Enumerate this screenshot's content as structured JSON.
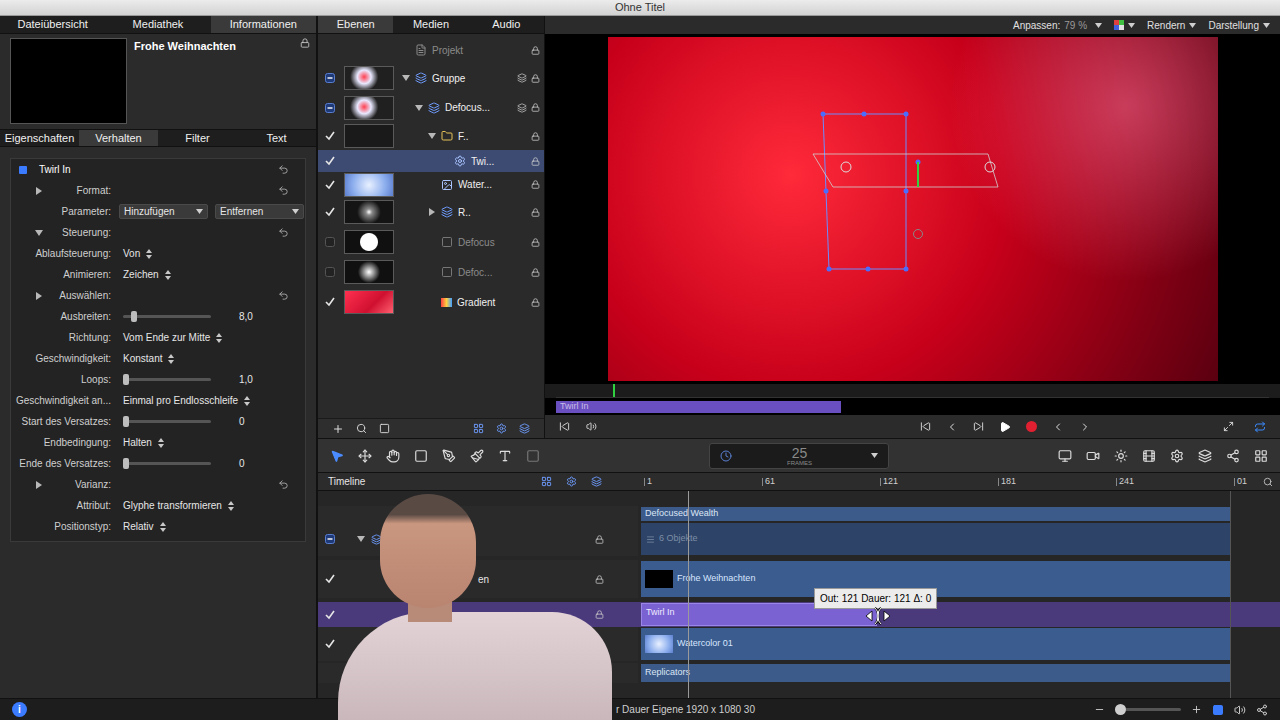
{
  "window": {
    "title": "Ohne Titel"
  },
  "inspector": {
    "tabs": [
      {
        "label": "Dateiübersicht",
        "selected": false
      },
      {
        "label": "Mediathek",
        "selected": false
      },
      {
        "label": "Informationen",
        "selected": true
      }
    ],
    "preview": {
      "title": "Frohe Weihnachten"
    },
    "subtabs": [
      {
        "label": "Eigenschaften",
        "selected": false
      },
      {
        "label": "Verhalten",
        "selected": true
      },
      {
        "label": "Filter",
        "selected": false
      },
      {
        "label": "Text",
        "selected": false
      }
    ],
    "behavior": {
      "name": "Twirl In",
      "enabled": true
    },
    "params": [
      {
        "kind": "section",
        "label": "Format:",
        "expanded": false
      },
      {
        "kind": "buttons",
        "label": "Parameter:",
        "buttons": [
          "Hinzufügen",
          "Entfernen"
        ]
      },
      {
        "kind": "section",
        "label": "Steuerung:",
        "expanded": true
      },
      {
        "kind": "popup",
        "label": "Ablaufsteuerung:",
        "value": "Von"
      },
      {
        "kind": "popup",
        "label": "Animieren:",
        "value": "Zeichen"
      },
      {
        "kind": "section",
        "label": "Auswählen:",
        "expanded": false
      },
      {
        "kind": "slider",
        "label": "Ausbreiten:",
        "value": "8,0",
        "level": 0.1
      },
      {
        "kind": "popup",
        "label": "Richtung:",
        "value": "Vom Ende zur Mitte"
      },
      {
        "kind": "popup",
        "label": "Geschwindigkeit:",
        "value": "Konstant"
      },
      {
        "kind": "slider",
        "label": "Loops:",
        "value": "1,0",
        "level": 0.0
      },
      {
        "kind": "popup",
        "label": "Geschwindigkeit an...",
        "value": "Einmal pro Endlosschleife"
      },
      {
        "kind": "slider",
        "label": "Start des Versatzes:",
        "value": "0",
        "level": 0.0
      },
      {
        "kind": "popup",
        "label": "Endbedingung:",
        "value": "Halten"
      },
      {
        "kind": "slider",
        "label": "Ende des Versatzes:",
        "value": "0",
        "level": 0.0
      },
      {
        "kind": "section",
        "label": "Varianz:",
        "expanded": false
      },
      {
        "kind": "popup",
        "label": "Attribut:",
        "value": "Glyphe transformieren"
      },
      {
        "kind": "popup",
        "label": "Positionstyp:",
        "value": "Relativ"
      }
    ]
  },
  "layers": {
    "tabs": [
      {
        "label": "Ebenen",
        "selected": true
      },
      {
        "label": "Medien",
        "selected": false
      },
      {
        "label": "Audio",
        "selected": false
      }
    ],
    "items": [
      {
        "name": "Projekt",
        "kind": "project",
        "check": "none",
        "indent": 0,
        "disclosure": "none",
        "thumb": "none",
        "dimmed": true,
        "selected": false
      },
      {
        "name": "Gruppe",
        "kind": "group",
        "check": "mixed",
        "indent": 0,
        "disclosure": "open",
        "thumb": "group",
        "dimmed": false,
        "selected": false
      },
      {
        "name": "Defocus...",
        "kind": "group",
        "check": "mixed",
        "indent": 1,
        "disclosure": "open",
        "thumb": "group",
        "dimmed": false,
        "selected": false
      },
      {
        "name": "F..",
        "kind": "text",
        "check": "checked",
        "indent": 2,
        "disclosure": "open",
        "thumb": "text",
        "dimmed": false,
        "selected": false
      },
      {
        "name": "Twi...",
        "kind": "behavior",
        "check": "checked",
        "indent": 3,
        "disclosure": "none",
        "thumb": "none",
        "dimmed": false,
        "selected": true
      },
      {
        "name": "Water...",
        "kind": "image",
        "check": "checked",
        "indent": 2,
        "disclosure": "none",
        "thumb": "watercolor",
        "dimmed": false,
        "selected": false
      },
      {
        "name": "R..",
        "kind": "group",
        "check": "checked",
        "indent": 2,
        "disclosure": "closed",
        "thumb": "replicator",
        "dimmed": false,
        "selected": false
      },
      {
        "name": "Defocus",
        "kind": "generator",
        "check": "unchecked",
        "indent": 2,
        "disclosure": "none",
        "thumb": "circle",
        "dimmed": true,
        "selected": false
      },
      {
        "name": "Defoc...",
        "kind": "generator",
        "check": "unchecked",
        "indent": 2,
        "disclosure": "none",
        "thumb": "softcircle",
        "dimmed": true,
        "selected": false
      },
      {
        "name": "Gradient",
        "kind": "gradient",
        "check": "checked",
        "indent": 2,
        "disclosure": "none",
        "thumb": "gradient",
        "dimmed": false,
        "selected": false
      }
    ]
  },
  "canvas": {
    "zoom": {
      "label": "Anpassen:",
      "value": "79 %"
    },
    "menus": [
      "Rendern",
      "Darstellung"
    ],
    "mini_timeline": {
      "playhead": 0.08,
      "bar": {
        "label": "Twirl In",
        "level": 0.4
      }
    }
  },
  "toolbar": {
    "lcd": {
      "value": "25",
      "unit": "FRAMES"
    }
  },
  "timeline": {
    "title": "Timeline",
    "ruler": [
      "1",
      "61",
      "121",
      "181",
      "241",
      "01"
    ],
    "playhead": 0.08,
    "rows": [
      {
        "kind": "header",
        "label": "Defocused Wealth",
        "check": "none",
        "selected": false
      },
      {
        "kind": "collapsed",
        "label": "6 Objekte",
        "check": "mixed",
        "selected": false
      },
      {
        "kind": "layer",
        "label": "Frohe Weihnachten",
        "list_label": "en",
        "check": "checked",
        "thumb": "black",
        "selected": false
      },
      {
        "kind": "behavior",
        "label": "Twirl In",
        "check": "checked",
        "selected": true,
        "level": 0.4
      },
      {
        "kind": "layer",
        "label": "Watercolor 01",
        "check": "checked",
        "thumb": "watercolor",
        "selected": false
      },
      {
        "kind": "header",
        "label": "Replicators",
        "check": "none",
        "selected": false
      }
    ],
    "tooltip": "Out: 121 Dauer: 121 Δ: 0"
  },
  "status_bar": {
    "info": "i",
    "text": "r Dauer Eigene 1920 x 1080 30"
  }
}
